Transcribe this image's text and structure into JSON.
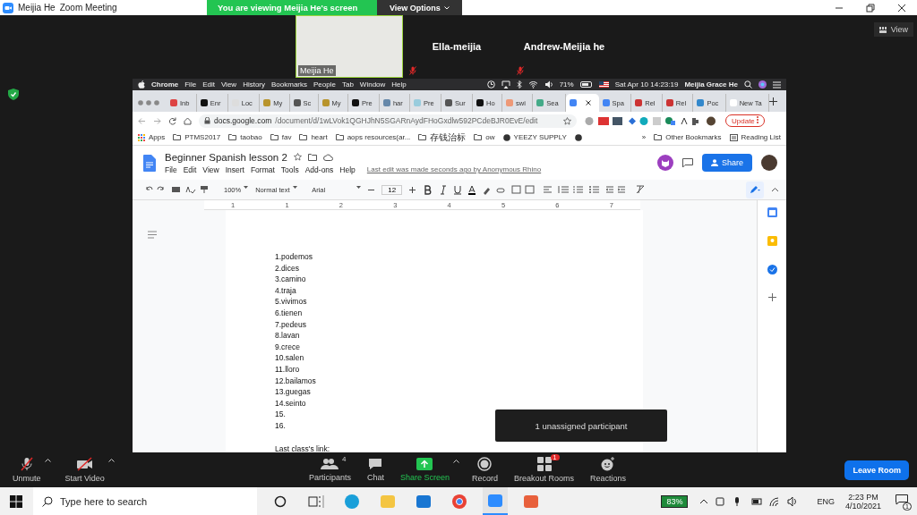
{
  "window": {
    "app_name": "Meijia He",
    "title": "Zoom Meeting"
  },
  "banner": {
    "text": "You are viewing Meijia He's screen",
    "options": "View Options"
  },
  "gallery": {
    "view_button": "View",
    "tiles": [
      {
        "kind": "video",
        "name": "Meijia He",
        "muted": false,
        "speaking": true
      },
      {
        "kind": "name",
        "name": "Ella-meijia",
        "muted": true,
        "speaking": false
      },
      {
        "kind": "name",
        "name": "Andrew-Meijia he",
        "muted": true,
        "speaking": false
      }
    ]
  },
  "mac_menu": {
    "items": [
      "Chrome",
      "File",
      "Edit",
      "View",
      "History",
      "Bookmarks",
      "People",
      "Tab",
      "Window",
      "Help"
    ],
    "battery": "71%",
    "clock": "Sat Apr 10  14:23:19",
    "user": "Meijia Grace He"
  },
  "tabs": [
    {
      "label": "Inb",
      "selected": false
    },
    {
      "label": "Enr",
      "selected": false
    },
    {
      "label": "Loc",
      "selected": false
    },
    {
      "label": "My",
      "selected": false
    },
    {
      "label": "Sc",
      "selected": false
    },
    {
      "label": "My",
      "selected": false
    },
    {
      "label": "Pre",
      "selected": false
    },
    {
      "label": "har",
      "selected": false
    },
    {
      "label": "Pre",
      "selected": false
    },
    {
      "label": "Sur",
      "selected": false
    },
    {
      "label": "Ho",
      "selected": false
    },
    {
      "label": "swi",
      "selected": false
    },
    {
      "label": "Sea",
      "selected": false
    },
    {
      "selected": true
    },
    {
      "label": "Spa",
      "selected": false
    },
    {
      "label": "Rel",
      "selected": false
    },
    {
      "label": "Rel",
      "selected": false
    },
    {
      "label": "Poc",
      "selected": false
    },
    {
      "label": "New Ta",
      "selected": false
    }
  ],
  "address": {
    "host": "docs.google.com",
    "path": "/document/d/1wLVok1QGHJhN5SGARnAydFHoGxdlw592PCdeBJR0EvE/edit",
    "update": "Update"
  },
  "bookmarks": {
    "items": [
      {
        "kind": "apps",
        "label": "Apps"
      },
      {
        "kind": "folder",
        "label": "PTMS2017"
      },
      {
        "kind": "folder",
        "label": "taobao"
      },
      {
        "kind": "folder",
        "label": "fav"
      },
      {
        "kind": "folder",
        "label": "heart"
      },
      {
        "kind": "folder",
        "label": "aops resources(ar..."
      },
      {
        "kind": "folder",
        "label": "存钱治标"
      },
      {
        "kind": "folder",
        "label": "ow"
      },
      {
        "kind": "site",
        "label": "YEEZY SUPPLY"
      },
      {
        "kind": "site"
      }
    ],
    "overflow": "»",
    "other": "Other Bookmarks",
    "reading": "Reading List"
  },
  "docs": {
    "title": "Beginner Spanish lesson 2",
    "menus": [
      "File",
      "Edit",
      "View",
      "Insert",
      "Format",
      "Tools",
      "Add-ons",
      "Help"
    ],
    "last_edit": "Last edit was made seconds ago by Anonymous Rhino",
    "share": "Share",
    "zoom": "100%",
    "style": "Normal text",
    "font": "Arial",
    "size": "12",
    "ruler": [
      "1",
      "1",
      "2",
      "3",
      "4",
      "5",
      "6",
      "7"
    ]
  },
  "document": {
    "lines": [
      "1.podemos",
      "2.dices",
      "3.camino",
      "4.traja",
      "5.vivimos",
      "6.tienen",
      "7.pedeus",
      "8.lavan",
      "9.crece",
      "10.salen",
      "11.lloro",
      "12.bailamos",
      "13.guegas",
      "14.seinto",
      "15.",
      "16."
    ],
    "link_label": "Last class's link:"
  },
  "tooltip": "1 unassigned participant",
  "zoom_toolbar": {
    "controls": [
      {
        "kind": "mic",
        "label": "Unmute",
        "muted": true,
        "caret": true
      },
      {
        "kind": "video",
        "label": "Start Video",
        "muted": true,
        "caret": true
      },
      {
        "kind": "participants",
        "label": "Participants",
        "count": "4",
        "caret": false
      },
      {
        "kind": "chat",
        "label": "Chat",
        "caret": false
      },
      {
        "kind": "share",
        "label": "Share Screen",
        "caret": true
      },
      {
        "kind": "record",
        "label": "Record",
        "caret": false
      },
      {
        "kind": "breakout",
        "label": "Breakout Rooms",
        "badge": "1",
        "caret": false
      },
      {
        "kind": "reactions",
        "label": "Reactions",
        "caret": false
      }
    ],
    "leave": "Leave Room"
  },
  "taskbar": {
    "search_placeholder": "Type here to search",
    "apps": [
      {
        "kind": "cortana",
        "selected": false
      },
      {
        "kind": "taskview",
        "selected": false
      },
      {
        "kind": "edge",
        "selected": false
      },
      {
        "kind": "files",
        "selected": false
      },
      {
        "kind": "mail",
        "selected": false
      },
      {
        "kind": "chrome",
        "selected": false
      },
      {
        "kind": "zoom",
        "selected": true
      },
      {
        "kind": "paint",
        "selected": false
      }
    ],
    "battery": "83%",
    "language": "ENG",
    "time": "2:23 PM",
    "date": "4/10/2021",
    "notifications": "1"
  }
}
